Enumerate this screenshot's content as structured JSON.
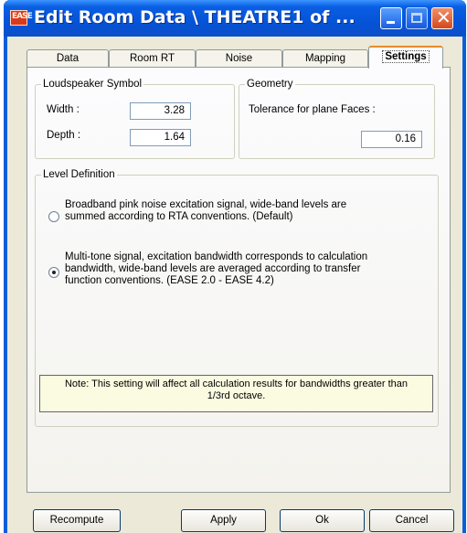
{
  "window": {
    "title": "Edit Room Data \\ THEATRE1 of ...",
    "icon_text": "EASE"
  },
  "tabs": [
    {
      "label": "Data"
    },
    {
      "label": "Room RT"
    },
    {
      "label": "Noise"
    },
    {
      "label": "Mapping"
    },
    {
      "label": "Settings",
      "active": true
    }
  ],
  "loudspeaker": {
    "legend": "Loudspeaker Symbol",
    "width_label": "Width :",
    "width_value": "3.28",
    "depth_label": "Depth :",
    "depth_value": "1.64"
  },
  "geometry": {
    "legend": "Geometry",
    "tolerance_label": "Tolerance for plane Faces :",
    "tolerance_value": "0.16"
  },
  "level": {
    "legend": "Level Definition",
    "option1": [
      "Broadband pink noise excitation signal, wide-band levels are",
      "summed according to RTA conventions. (Default)"
    ],
    "option2": [
      "Multi-tone signal, excitation bandwidth corresponds to calculation",
      "bandwidth, wide-band levels are averaged according to transfer",
      "function conventions. (EASE 2.0 - EASE 4.2)"
    ],
    "selected_option": 2,
    "note": [
      "Note: This setting will affect all calculation results for bandwidths greater than",
      "1/3rd octave."
    ]
  },
  "buttons": {
    "recompute": "Recompute",
    "apply": "Apply",
    "ok": "Ok",
    "cancel": "Cancel"
  }
}
